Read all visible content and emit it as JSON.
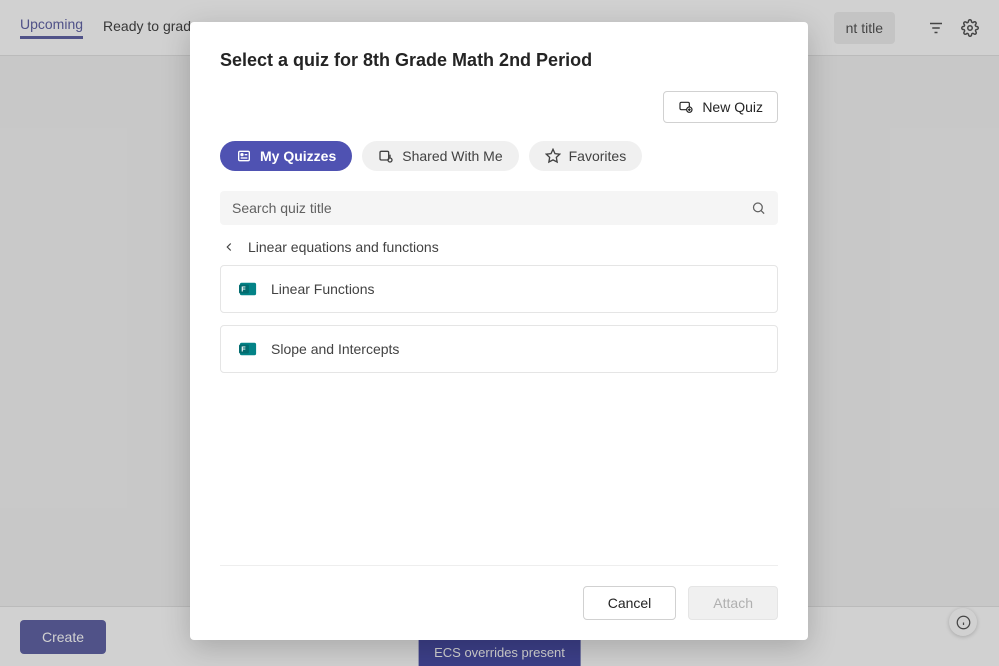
{
  "page": {
    "tabs": {
      "upcoming": "Upcoming",
      "ready": "Ready to grade"
    },
    "title_hint_fragment": "nt title",
    "create_button": "Create",
    "ecs_badge": "ECS overrides present"
  },
  "dialog": {
    "title": "Select a quiz for 8th Grade Math 2nd Period",
    "new_quiz_button": "New Quiz",
    "pills": {
      "my_quizzes": "My Quizzes",
      "shared_with_me": "Shared With Me",
      "favorites": "Favorites"
    },
    "search_placeholder": "Search quiz title",
    "breadcrumb": "Linear equations and functions",
    "quizzes": [
      {
        "name": "Linear Functions"
      },
      {
        "name": "Slope and Intercepts"
      }
    ],
    "buttons": {
      "cancel": "Cancel",
      "attach": "Attach"
    }
  }
}
